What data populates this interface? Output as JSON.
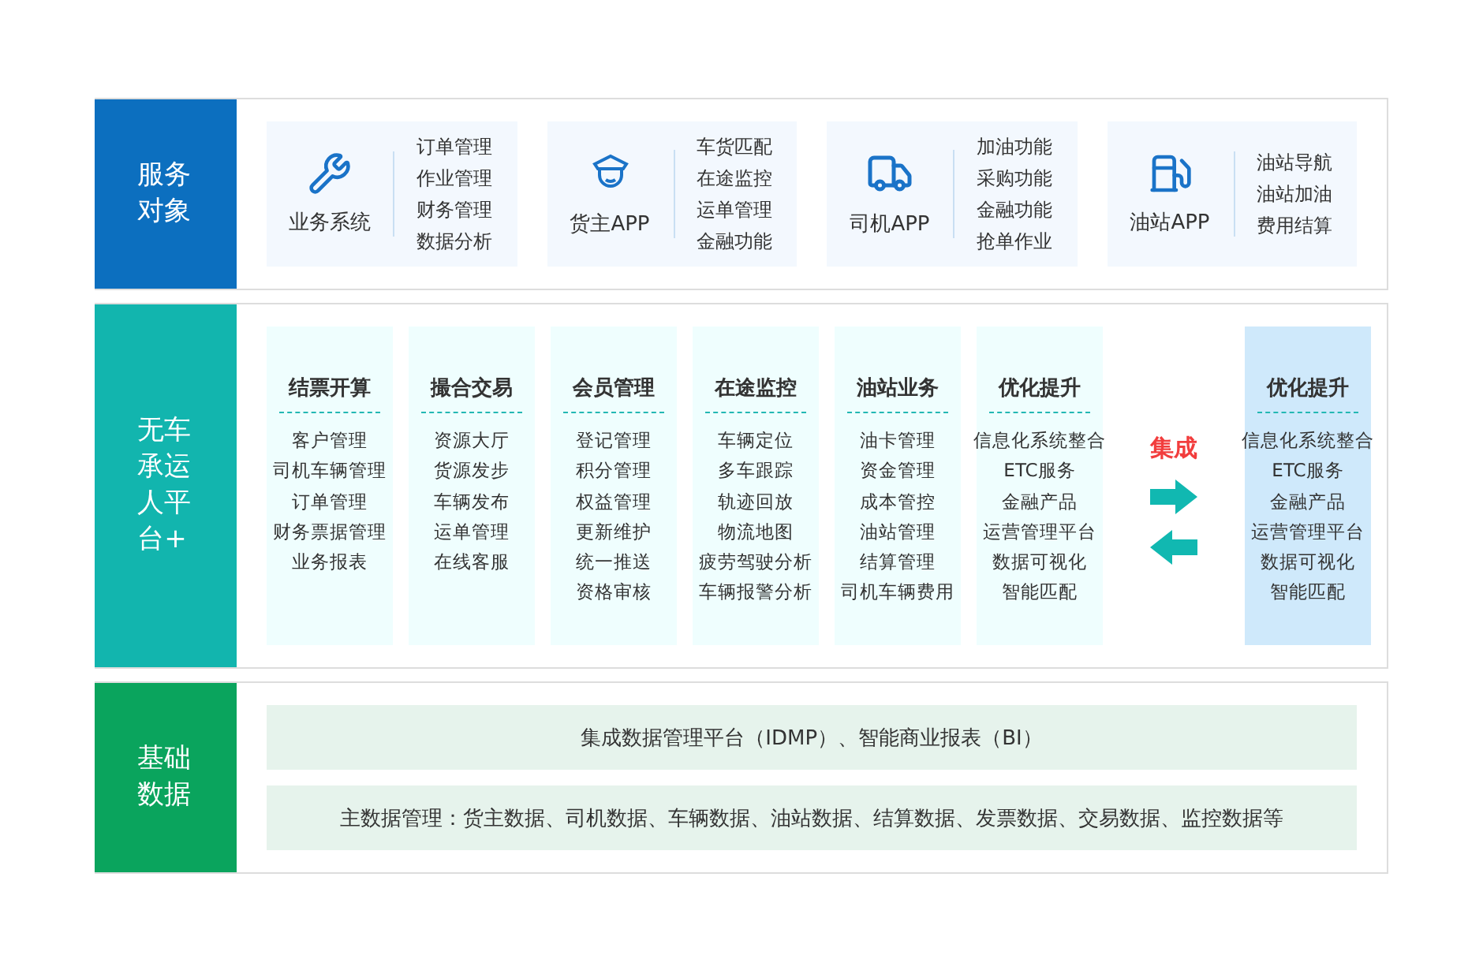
{
  "service_layer": {
    "label": "服务对象",
    "items": [
      {
        "name": "业务系统",
        "features": [
          "订单管理",
          "作业管理",
          "财务管理",
          "数据分析"
        ]
      },
      {
        "name": "货主APP",
        "features": [
          "车货匹配",
          "在途监控",
          "运单管理",
          "金融功能"
        ]
      },
      {
        "name": "司机APP",
        "features": [
          "加油功能",
          "采购功能",
          "金融功能",
          "抢单作业"
        ]
      },
      {
        "name": "油站APP",
        "features": [
          "油站导航",
          "油站加油",
          "费用结算"
        ]
      }
    ]
  },
  "platform_layer": {
    "label": "无车承运人平台+",
    "modules": [
      {
        "kind": "module",
        "title": "结票开算",
        "items": [
          "客户管理",
          "司机车辆管理",
          "订单管理",
          "财务票据管理",
          "业务报表"
        ]
      },
      {
        "kind": "module",
        "title": "撮合交易",
        "items": [
          "资源大厅",
          "货源发步",
          "车辆发布",
          "运单管理",
          "在线客服"
        ]
      },
      {
        "kind": "module",
        "title": "会员管理",
        "items": [
          "登记管理",
          "积分管理",
          "权益管理",
          "更新维护",
          "统一推送",
          "资格审核"
        ]
      },
      {
        "kind": "module",
        "title": "在途监控",
        "items": [
          "车辆定位",
          "多车跟踪",
          "轨迹回放",
          "物流地图",
          "疲劳驾驶分析",
          "车辆报警分析"
        ]
      },
      {
        "kind": "module",
        "title": "油站业务",
        "items": [
          "油卡管理",
          "资金管理",
          "成本管控",
          "油站管理",
          "结算管理",
          "司机车辆费用"
        ]
      },
      {
        "kind": "module",
        "title": "优化提升",
        "items": [
          "信息化系统整合",
          "ETC服务",
          "金融产品",
          "运营管理平台",
          "数据可视化",
          "智能匹配"
        ]
      },
      {
        "kind": "connector",
        "title": "集成"
      },
      {
        "kind": "external",
        "title": "优化提升",
        "items": [
          "信息化系统整合",
          "ETC服务",
          "金融产品",
          "运营管理平台",
          "数据可视化",
          "智能匹配"
        ]
      }
    ]
  },
  "data_layer": {
    "label": "基础数据",
    "rows": [
      "集成数据管理平台（IDMP）、智能商业报表（BI）",
      "主数据管理：货主数据、司机数据、车辆数据、油站数据、结算数据、发票数据、交易数据、监控数据等"
    ]
  }
}
